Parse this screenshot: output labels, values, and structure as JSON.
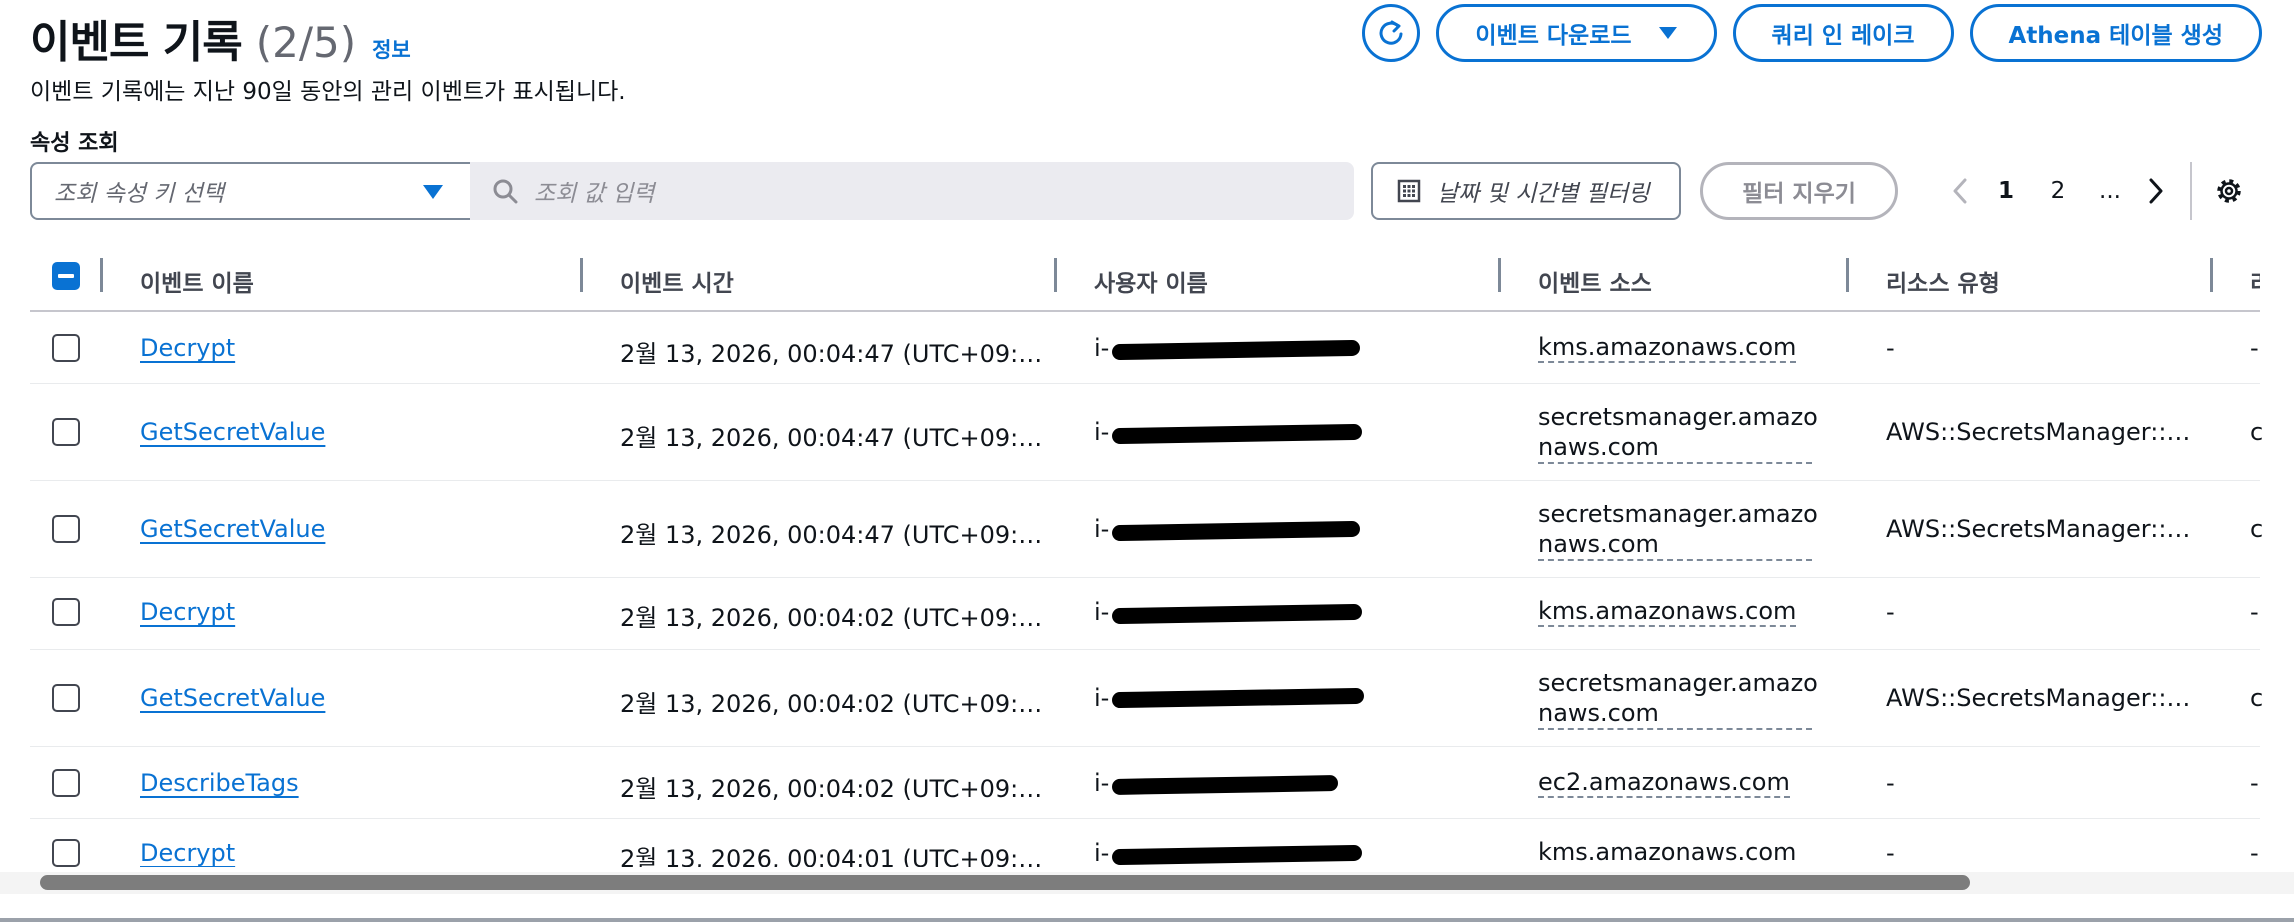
{
  "header": {
    "title": "이벤트 기록",
    "count": "(2/5)",
    "info_link": "정보",
    "description": "이벤트 기록에는 지난 90일 동안의 관리 이벤트가 표시됩니다."
  },
  "actions": {
    "refresh_icon": "refresh-icon",
    "download_label": "이벤트 다운로드",
    "lake_label": "쿼리 인 레이크",
    "athena_label": "Athena 테이블 생성"
  },
  "filter": {
    "attribute_label": "속성 조회",
    "attribute_placeholder": "조회 속성 키 선택",
    "value_placeholder": "조회 값 입력",
    "date_label": "날짜 및 시간별 필터링",
    "clear_label": "필터 지우기"
  },
  "pagination": {
    "pages": [
      "1",
      "2",
      "..."
    ],
    "current": "1"
  },
  "table": {
    "columns": [
      "이벤트 이름",
      "이벤트 시간",
      "사용자 이름",
      "이벤트 소스",
      "리소스 유형",
      "리"
    ],
    "rows": [
      {
        "name": "Decrypt",
        "time": "2월 13, 2026, 00:04:47 (UTC+09:…",
        "user": "i-",
        "source_line1": "kms.amazonaws.com",
        "source_line2": "",
        "resource": "-",
        "extra": "-"
      },
      {
        "name": "GetSecretValue",
        "time": "2월 13, 2026, 00:04:47 (UTC+09:…",
        "user": "i-",
        "source_line1": "secretsmanager.amazo",
        "source_line2": "naws.com",
        "resource": "AWS::SecretsManager::…",
        "extra": "c"
      },
      {
        "name": "GetSecretValue",
        "time": "2월 13, 2026, 00:04:47 (UTC+09:…",
        "user": "i-",
        "source_line1": "secretsmanager.amazo",
        "source_line2": "naws.com",
        "resource": "AWS::SecretsManager::…",
        "extra": "c"
      },
      {
        "name": "Decrypt",
        "time": "2월 13, 2026, 00:04:02 (UTC+09:…",
        "user": "i-",
        "source_line1": "kms.amazonaws.com",
        "source_line2": "",
        "resource": "-",
        "extra": "-"
      },
      {
        "name": "GetSecretValue",
        "time": "2월 13, 2026, 00:04:02 (UTC+09:…",
        "user": "i-",
        "source_line1": "secretsmanager.amazo",
        "source_line2": "naws.com",
        "resource": "AWS::SecretsManager::…",
        "extra": "c"
      },
      {
        "name": "DescribeTags",
        "time": "2월 13, 2026, 00:04:02 (UTC+09:…",
        "user": "i-",
        "source_line1": "ec2.amazonaws.com",
        "source_line2": "",
        "resource": "-",
        "extra": "-"
      },
      {
        "name": "Decrypt",
        "time": "2월 13, 2026, 00:04:01 (UTC+09:…",
        "user": "i-",
        "source_line1": "kms.amazonaws.com",
        "source_line2": "",
        "resource": "-",
        "extra": "-"
      }
    ]
  },
  "colors": {
    "accent": "#0972d3",
    "text": "#0f141a",
    "muted": "#656871"
  }
}
